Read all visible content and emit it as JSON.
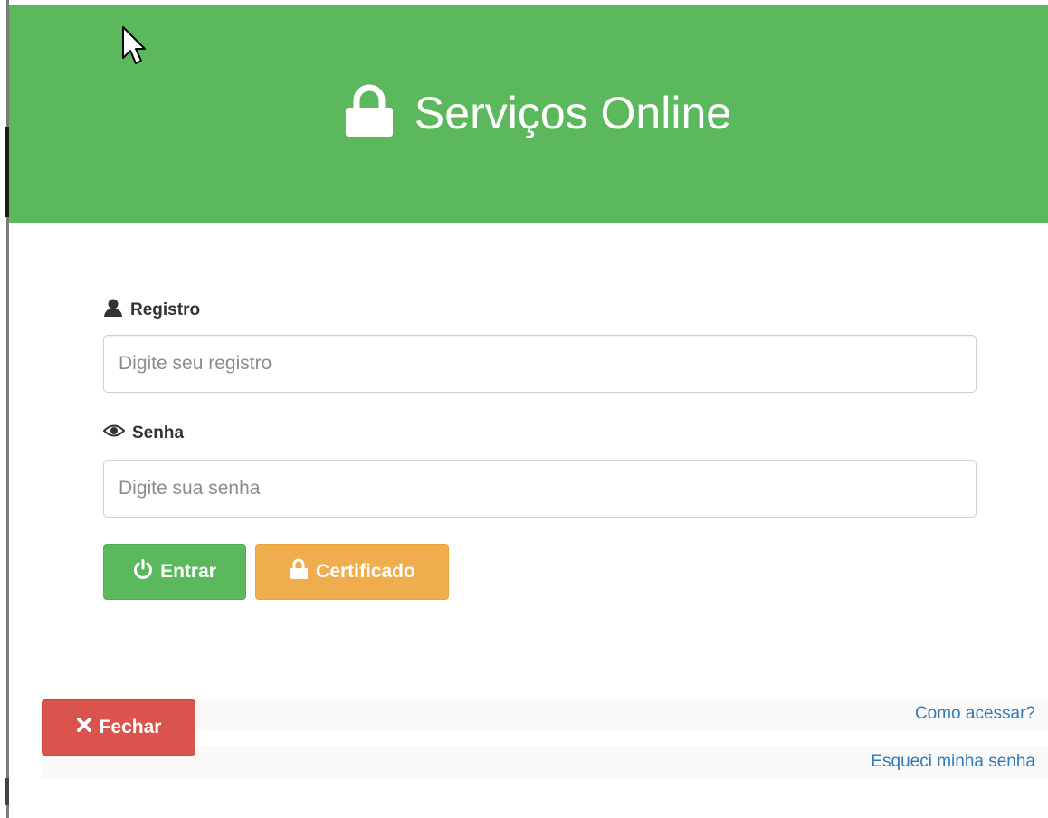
{
  "header": {
    "title": "Serviços Online",
    "icon": "lock-icon",
    "background_color": "#5cb85c"
  },
  "form": {
    "registro": {
      "label": "Registro",
      "icon": "user-icon",
      "placeholder": "Digite seu registro",
      "value": ""
    },
    "senha": {
      "label": "Senha",
      "icon": "eye-icon",
      "placeholder": "Digite sua senha",
      "value": ""
    }
  },
  "buttons": {
    "entrar": {
      "label": "Entrar",
      "icon": "power-icon",
      "color": "#5cb85c"
    },
    "certificado": {
      "label": "Certificado",
      "icon": "lock-icon",
      "color": "#f0ad4e"
    },
    "fechar": {
      "label": "Fechar",
      "icon": "close-icon",
      "color": "#d9534f"
    }
  },
  "footer": {
    "como_acessar": "Como acessar?",
    "esqueci_senha": "Esqueci minha senha",
    "link_color": "#337ab7"
  }
}
